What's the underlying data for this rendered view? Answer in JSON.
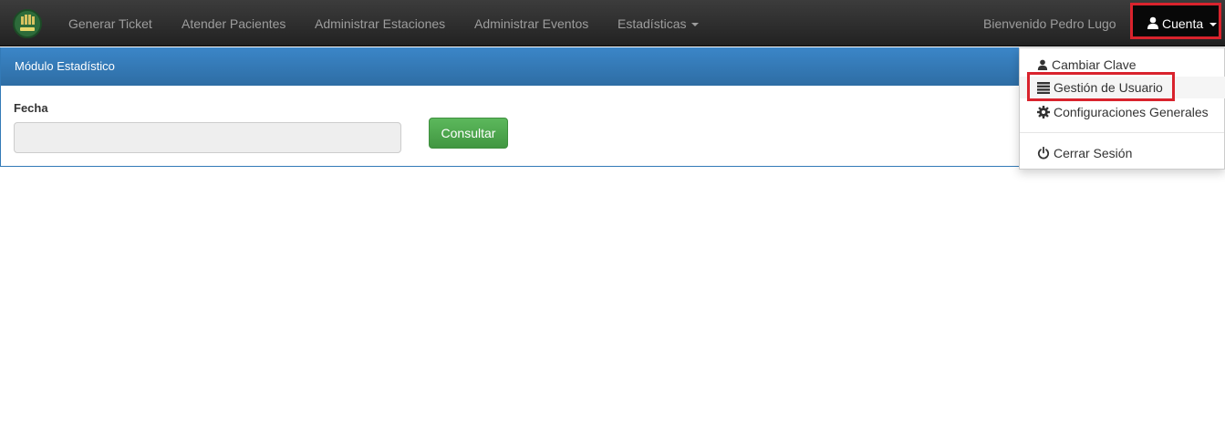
{
  "navbar": {
    "logo": "hospital-logo",
    "items": [
      {
        "label": "Generar Ticket"
      },
      {
        "label": "Atender Pacientes"
      },
      {
        "label": "Administrar Estaciones"
      },
      {
        "label": "Administrar Eventos"
      },
      {
        "label": "Estadísticas",
        "icon": "caret-down-icon"
      }
    ],
    "welcome": "Bienvenido Pedro Lugo",
    "account": {
      "label": "Cuenta",
      "icon": "user-icon"
    }
  },
  "panel": {
    "title": "Módulo Estadístico",
    "date_label": "Fecha",
    "date_value": "",
    "submit_label": "Consultar"
  },
  "dropdown": {
    "items": [
      {
        "label": "Cambiar Clave",
        "icon": "user-icon"
      },
      {
        "label": "Gestión de Usuario",
        "icon": "list-icon"
      },
      {
        "label": "Configuraciones Generales",
        "icon": "gear-icon"
      },
      {
        "label": "Cerrar Sesión",
        "icon": "power-icon"
      }
    ]
  },
  "colors": {
    "navbar": "#222222",
    "panel_heading": "#337ab7",
    "button": "#5cb85c",
    "highlight": "#d9232d"
  }
}
